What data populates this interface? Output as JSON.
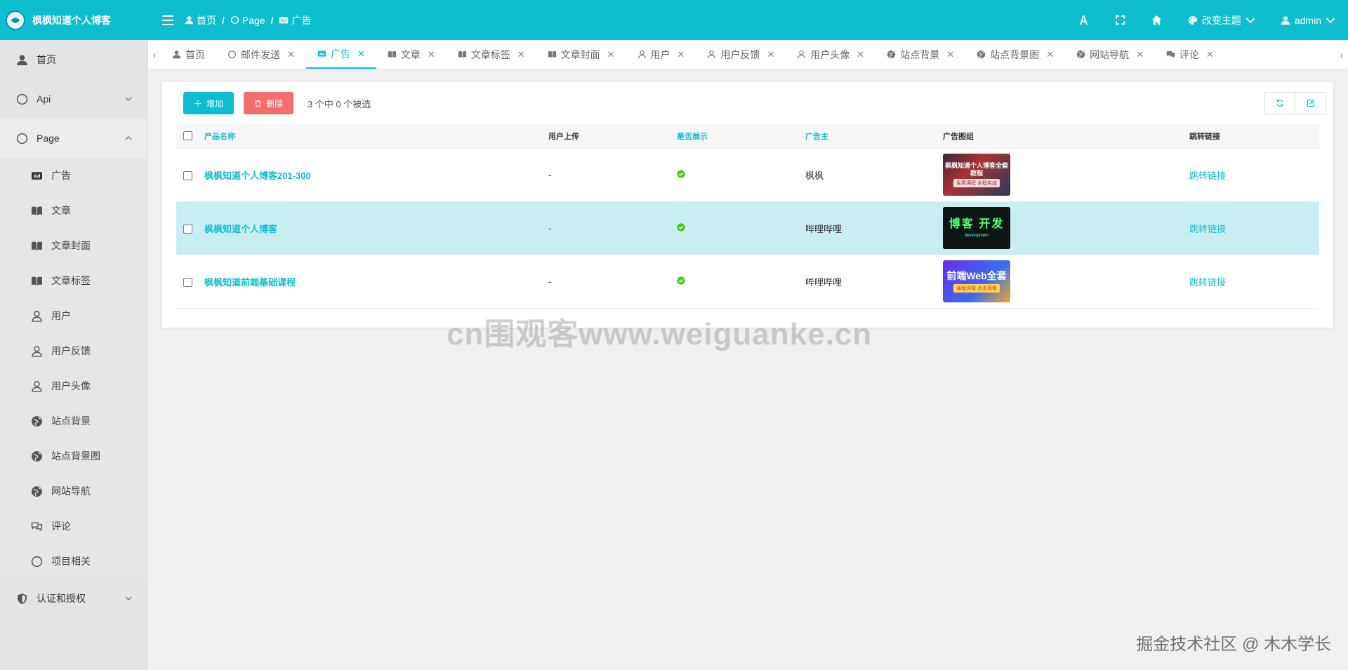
{
  "header": {
    "brand_title": "枫枫知道个人博客",
    "breadcrumbs": [
      "首页",
      "Page",
      "广告"
    ],
    "theme_label": "改变主题",
    "user_label": "admin"
  },
  "sidebar": {
    "items": [
      {
        "label": "首页"
      },
      {
        "label": "Api"
      },
      {
        "label": "Page"
      }
    ],
    "page_children": [
      "广告",
      "文章",
      "文章封面",
      "文章标签",
      "用户",
      "用户反馈",
      "用户头像",
      "站点背景",
      "站点背景图",
      "网站导航",
      "评论",
      "项目相关"
    ],
    "auth_label": "认证和授权"
  },
  "tabs": [
    {
      "label": "首页",
      "closable": false
    },
    {
      "label": "邮件发送",
      "closable": true
    },
    {
      "label": "广告",
      "closable": true,
      "active": true
    },
    {
      "label": "文章",
      "closable": true
    },
    {
      "label": "文章标签",
      "closable": true
    },
    {
      "label": "文章封面",
      "closable": true
    },
    {
      "label": "用户",
      "closable": true
    },
    {
      "label": "用户反馈",
      "closable": true
    },
    {
      "label": "用户头像",
      "closable": true
    },
    {
      "label": "站点背景",
      "closable": true
    },
    {
      "label": "站点背景图",
      "closable": true
    },
    {
      "label": "网站导航",
      "closable": true
    },
    {
      "label": "评论",
      "closable": true
    }
  ],
  "toolbar": {
    "add_label": "增加",
    "delete_label": "删除",
    "selection_info": "3 个中 0 个被选"
  },
  "table": {
    "columns": [
      "产品名称",
      "用户上传",
      "是否展示",
      "广告主",
      "广告图组",
      "跳转链接"
    ],
    "rows": [
      {
        "name": "枫枫知道个人博客201-300",
        "uploaded": "-",
        "advertiser": "枫枫",
        "link": "跳转链接",
        "thumb_title": "枫枫知道个人博客全套教程",
        "thumb_sub": "免费课程 全程实战"
      },
      {
        "name": "枫枫知道个人博客",
        "uploaded": "-",
        "advertiser": "哔哩哔哩",
        "link": "跳转链接",
        "thumb_title": "博客 开发",
        "thumb_sub": "development"
      },
      {
        "name": "枫枫知道前端基础课程",
        "uploaded": "-",
        "advertiser": "哔哩哔哩",
        "link": "跳转链接",
        "thumb_title": "前端Web全套",
        "thumb_sub": "课程详情 点击观看"
      }
    ]
  },
  "watermarks": {
    "center": "cn围观客www.weiguanke.cn",
    "bottom_right": "掘金技术社区 @ 木木学长"
  },
  "colors": {
    "accent": "#0ebed0",
    "danger": "#f56c6c",
    "highlight_row": "#c8eef1",
    "success": "#52c41a"
  }
}
